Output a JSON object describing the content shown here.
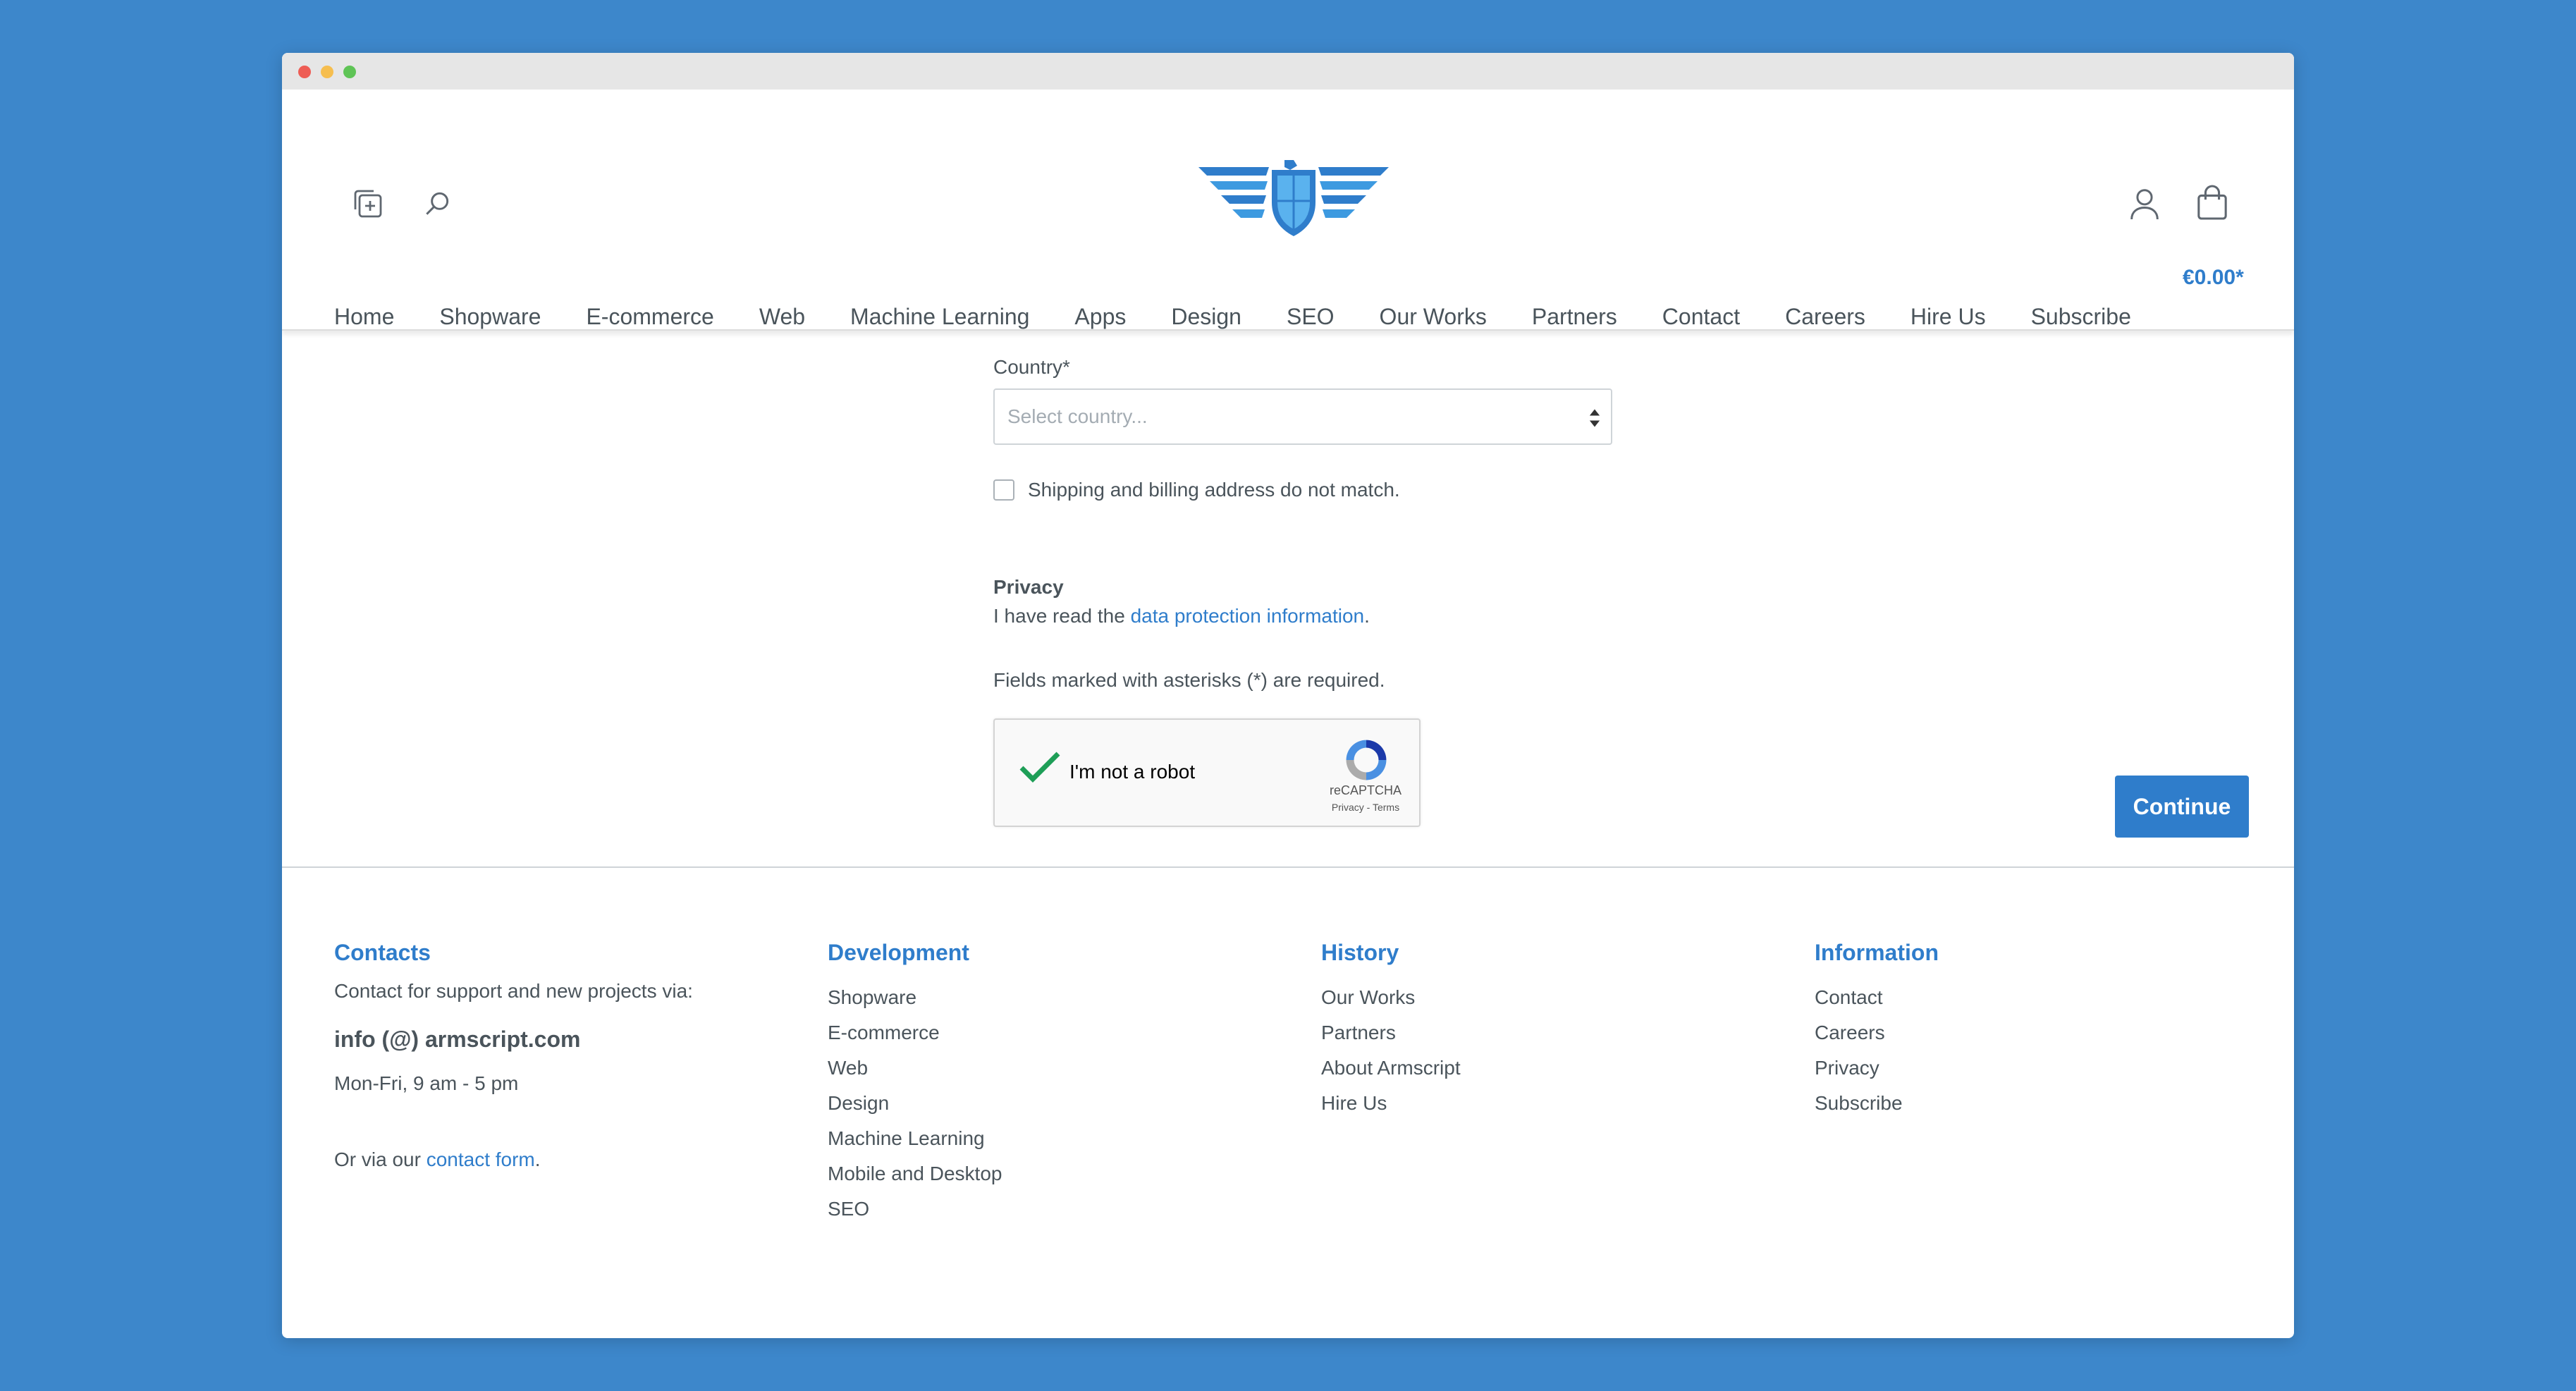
{
  "header": {
    "cart_total": "€0.00*",
    "nav": [
      "Home",
      "Shopware",
      "E-commerce",
      "Web",
      "Machine Learning",
      "Apps",
      "Design",
      "SEO",
      "Our Works",
      "Partners",
      "Contact",
      "Careers",
      "Hire Us",
      "Subscribe"
    ]
  },
  "form": {
    "country_label": "Country*",
    "country_placeholder": "Select country...",
    "shipping_checkbox_label": "Shipping and billing address do not match.",
    "privacy_title": "Privacy",
    "privacy_text_before": "I have read the ",
    "privacy_link": "data protection information",
    "privacy_text_after": ".",
    "required_note": "Fields marked with asterisks (*) are required.",
    "continue_label": "Continue"
  },
  "recaptcha": {
    "label": "I'm not a robot",
    "brand": "reCAPTCHA",
    "links": "Privacy - Terms",
    "checked": true
  },
  "footer": {
    "contacts": {
      "title": "Contacts",
      "intro": "Contact for support and new projects via:",
      "email": "info (@) armscript.com",
      "hours": "Mon-Fri, 9 am - 5 pm",
      "form_before": "Or via our ",
      "form_link": "contact form",
      "form_after": "."
    },
    "development": {
      "title": "Development",
      "links": [
        "Shopware",
        "E-commerce",
        "Web",
        "Design",
        "Machine Learning",
        "Mobile and Desktop",
        "SEO"
      ]
    },
    "history": {
      "title": "History",
      "links": [
        "Our Works",
        "Partners",
        "About Armscript",
        "Hire Us"
      ]
    },
    "information": {
      "title": "Information",
      "links": [
        "Contact",
        "Careers",
        "Privacy",
        "Subscribe"
      ]
    }
  },
  "colors": {
    "accent": "#2f7dcb",
    "background": "#3d87cb",
    "text": "#4a545b",
    "check": "#1e9e57"
  }
}
